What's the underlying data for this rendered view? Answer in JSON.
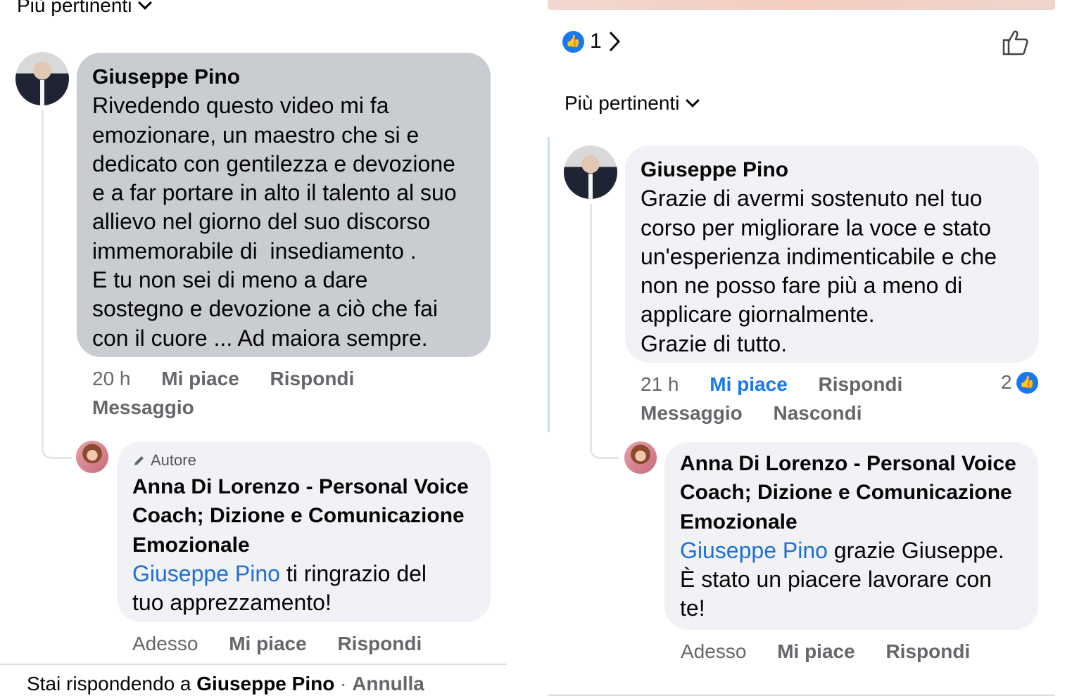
{
  "left": {
    "sort_label": "Più pertinenti",
    "comment": {
      "author": "Giuseppe Pino",
      "lines": [
        "Rivedendo questo video mi fa",
        "emozionare, un maestro che si e",
        "dedicato con gentilezza e devozione",
        "e a far portare in alto il talento al suo",
        "allievo nel giorno del suo discorso",
        "immemorabile di  insediamento .",
        "E tu non sei di meno a dare",
        "sostegno e devozione a ciò che fai",
        "con il cuore ... Ad maiora sempre."
      ],
      "time": "20 h",
      "like": "Mi piace",
      "reply": "Rispondi",
      "message": "Messaggio"
    },
    "reply": {
      "badge": "Autore",
      "author_lines": [
        "Anna Di Lorenzo - Personal Voice",
        "Coach; Dizione e Comunicazione",
        "Emozionale"
      ],
      "mention": "Giuseppe Pino",
      "text_first": " ti ringrazio del",
      "text_rest": "tuo apprezzamento!",
      "time": "Adesso",
      "like": "Mi piace",
      "reply": "Rispondi"
    },
    "replying_bar": {
      "prefix": "Stai rispondendo a ",
      "name": "Giuseppe Pino",
      "separator": " · ",
      "cancel": "Annulla"
    }
  },
  "right": {
    "reaction_count": "1",
    "sort_label": "Più pertinenti",
    "comment": {
      "author": "Giuseppe Pino",
      "lines": [
        "Grazie di avermi sostenuto nel tuo",
        "corso per migliorare la voce e stato",
        "un'esperienza indimenticabile e che",
        "non ne posso fare più a meno di",
        "applicare giornalmente.",
        "Grazie di tutto."
      ],
      "time": "21 h",
      "like": "Mi piace",
      "reply": "Rispondi",
      "like_count": "2",
      "message": "Messaggio",
      "hide": "Nascondi"
    },
    "reply": {
      "author_lines": [
        "Anna Di Lorenzo - Personal Voice",
        "Coach; Dizione e Comunicazione",
        "Emozionale"
      ],
      "mention": "Giuseppe Pino",
      "text_first": " grazie Giuseppe.",
      "text_line2": "È stato un piacere lavorare con",
      "text_line3": "te!",
      "time": "Adesso",
      "like": "Mi piace",
      "reply": "Rispondi"
    }
  },
  "colors": {
    "accent": "#1877f2",
    "mention": "#1d6fd8",
    "selected_bubble": "#c9ccd1",
    "bubble": "#f0f2f5",
    "meta_text": "#65676b"
  }
}
